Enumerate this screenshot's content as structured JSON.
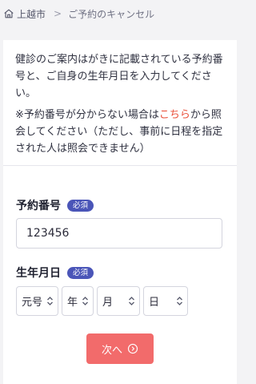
{
  "breadcrumb": {
    "home_label": "上越市",
    "separator": ">",
    "current": "ご予約のキャンセル"
  },
  "intro": {
    "line1": "健診のご案内はがきに記載されている予約番号と、ご自身の生年月日を入力してください。",
    "note_before": "※予約番号が分からない場合は",
    "note_link": "こちら",
    "note_after": "から照会してください（ただし、事前に日程を指定された人は照会できません）"
  },
  "form": {
    "reservation_label": "予約番号",
    "required_badge": "必須",
    "reservation_value": "123456",
    "birthdate_label": "生年月日",
    "era_value": "元号",
    "year_value": "年",
    "month_value": "月",
    "day_value": "日"
  },
  "actions": {
    "next_label": "次へ"
  },
  "colors": {
    "accent_badge": "#4a55b8",
    "next_button": "#f26b6b",
    "link": "#e9503a"
  }
}
